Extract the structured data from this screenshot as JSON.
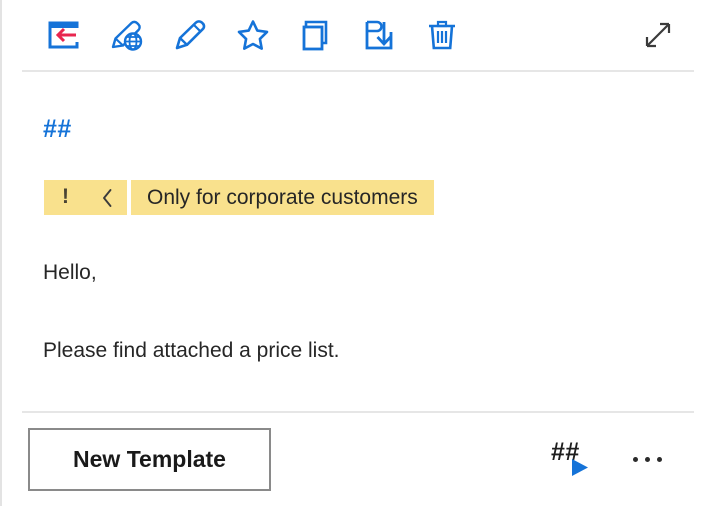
{
  "toolbar": {
    "items": [
      {
        "name": "insert-template-icon",
        "label": "Insert template"
      },
      {
        "name": "edit-public-template-icon",
        "label": "Edit public template"
      },
      {
        "name": "edit-template-icon",
        "label": "Edit template"
      },
      {
        "name": "favorite-star-icon",
        "label": "Add to favorites"
      },
      {
        "name": "copy-template-icon",
        "label": "Copy template"
      },
      {
        "name": "save-template-icon",
        "label": "Save template"
      },
      {
        "name": "delete-template-icon",
        "label": "Delete template"
      }
    ],
    "expand": {
      "name": "expand-icon",
      "label": "Expand"
    }
  },
  "content": {
    "subject": "##",
    "notice": {
      "icon": "!",
      "chevron": "‹",
      "text": "Only for corporate customers"
    },
    "greeting": "Hello,",
    "message": "Please find attached a price list."
  },
  "footer": {
    "new_template_label": "New Template",
    "insert_placeholder": {
      "label": "##",
      "name": "insert-placeholder-button"
    },
    "more_options_label": "…"
  },
  "colors": {
    "accent_blue": "#1573d8",
    "notice_bg": "#f9e18d",
    "arrow_red": "#e8264f",
    "text": "#262626",
    "border": "#e6e6e6"
  }
}
